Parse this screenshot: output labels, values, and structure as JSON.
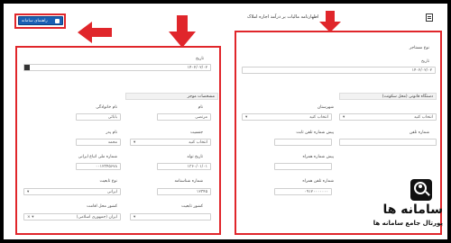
{
  "header": {
    "title": "اظهارنامه مالیات بر درآمد اجاره املاک",
    "page_icon": "document-icon"
  },
  "toolbar": {
    "button_label": "راهنمای سامانه",
    "button_icon": "save-icon"
  },
  "right_panel": {
    "section1_label": "نوع مستاجر",
    "date_label": "تاریخ",
    "date_value": "۱۴۰۲/۰۲/۰۲",
    "section2_label": "دستگاه قانونی (محل سکونت)",
    "province_label": "شهرستان",
    "province_value": "انتخاب کنید",
    "city_value": "انتخاب کنید",
    "postcode_label": "پیش شماره تلفن ثابت",
    "phone_label": "شماره تلفن",
    "mobile_prefix_label": "پیش شماره همراه",
    "mobile_label": "شماره تلفن همراه",
    "mobile_value": "۰۹۱۲۰۰۰۰۰۰۰"
  },
  "left_panel": {
    "date_label": "تاریخ",
    "date_value": "۱۴۰۲/۰۲/۰۲",
    "section_label": "مشخصات موجر",
    "father_name_label": "نام خانوادگی",
    "father_name_value": "بابائی",
    "first_name_label": "نام",
    "first_name_value": "مرتضی",
    "father_label": "نام پدر",
    "father_value": "محمد",
    "gender_label": "جنسیت",
    "gender_value": "انتخاب کنید",
    "national_id_label": "شماره ملی اتباع ایرانی",
    "national_id_value": "۰۰۱۲۳۴۵۶۷۸",
    "birth_date_label": "تاریخ تولد",
    "birth_date_value": "۱۳۶۰/۰۱/۰۱",
    "id_number_label": "شماره شناسنامه",
    "id_number_value": "۱۲۳۴۵",
    "nationality_label": "نوع تابعیت",
    "nationality_value": "ایرانی",
    "issue_place_label": "محل صدور",
    "issue_place_value": "تهران",
    "country_label": "کشور محل اقامت",
    "country_value": "ایران (جمهوری اسلامی)",
    "residence_label": "کشور تابعیت"
  },
  "logo": {
    "brand": "سامانه ها",
    "tagline": "پورتال جامع سامانه ها",
    "icon": "magnifier-person-icon"
  },
  "colors": {
    "highlight": "#e0262b",
    "button": "#1a5fb4",
    "background": "#000000"
  }
}
